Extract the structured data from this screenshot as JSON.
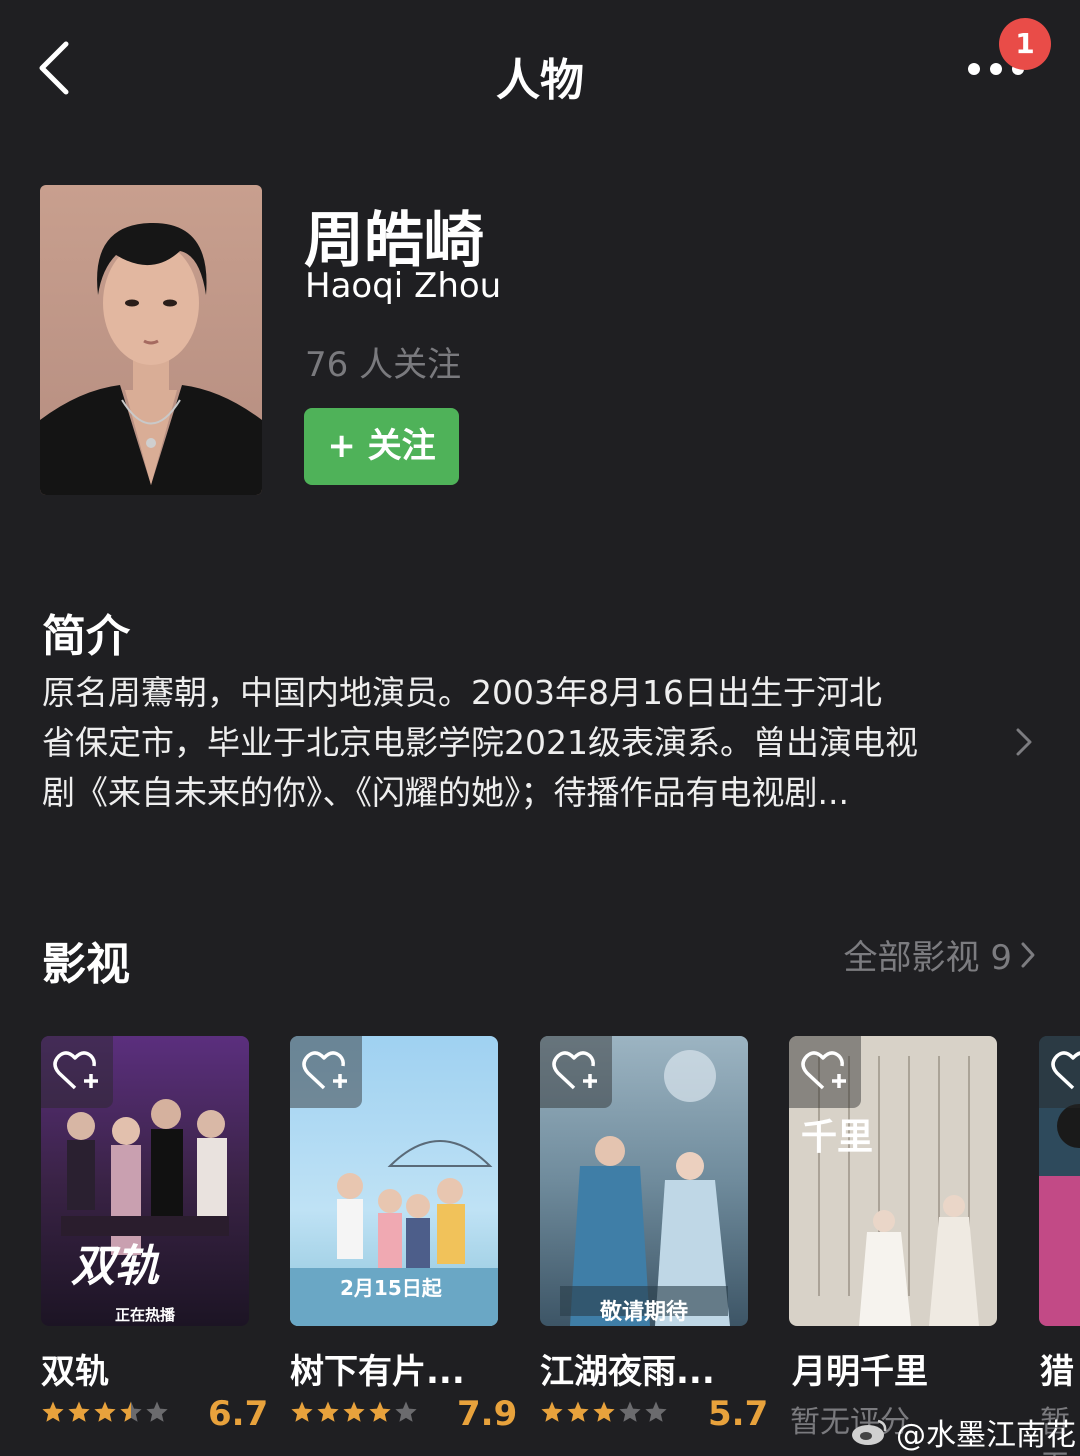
{
  "header": {
    "title": "人物",
    "badge_count": "1"
  },
  "person": {
    "name": "周皓崎",
    "name_en": "Haoqi Zhou",
    "followers": "76 人关注",
    "follow_label": "+ 关注"
  },
  "intro": {
    "heading": "简介",
    "lines": [
      "原名周鶱朝，中国内地演员。2003年8月16日出生于河北",
      "省保定市，毕业于北京电影学院2021级表演系。曾出演电视",
      "剧《来自未来的你》、《闪耀的她》；待播作品有电视剧..."
    ]
  },
  "works": {
    "heading": "影视",
    "all_label": "全部影视 9",
    "items": [
      {
        "title": "双轨",
        "rating": "6.7",
        "stars": 3.5,
        "poster_label": "正在热播",
        "poster_title": "双轨"
      },
      {
        "title": "树下有片...",
        "rating": "7.9",
        "stars": 4,
        "poster_label": "2月15日起"
      },
      {
        "title": "江湖夜雨...",
        "rating": "5.7",
        "stars": 3,
        "poster_label": "敬请期待"
      },
      {
        "title": "月明千里",
        "rating": "暂无评分",
        "stars": 0,
        "poster_title": "千里"
      },
      {
        "title": "猎",
        "rating": "暂无"
      }
    ]
  },
  "watermark": "@水墨江南花",
  "colors": {
    "background": "#1f1f22",
    "accent_green": "#4fb259",
    "rating_orange": "#e8a23c",
    "badge_red": "#e94c48",
    "muted": "#7a7a7e"
  }
}
